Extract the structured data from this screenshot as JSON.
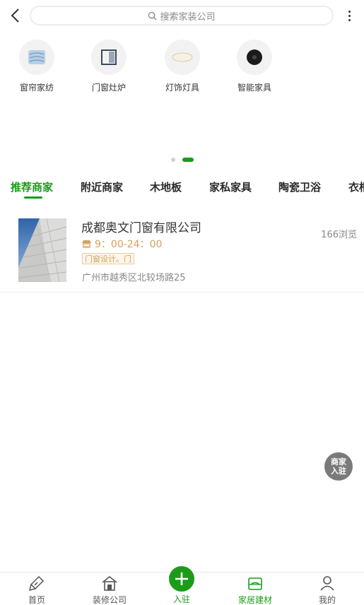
{
  "header": {
    "back_icon": "chevron-left-icon",
    "search_placeholder": "搜索家装公司",
    "more_icon": "more-vertical-icon"
  },
  "categories": [
    {
      "label": "窗帘家纺",
      "icon": "curtain-icon"
    },
    {
      "label": "门窗灶炉",
      "icon": "door-window-icon"
    },
    {
      "label": "灯饰灯具",
      "icon": "ceiling-lamp-icon"
    },
    {
      "label": "智能家具",
      "icon": "smart-speaker-icon"
    }
  ],
  "pager": {
    "count": 2,
    "active": 1
  },
  "tabs": [
    {
      "label": "推荐商家",
      "active": true
    },
    {
      "label": "附近商家",
      "active": false
    },
    {
      "label": "木地板",
      "active": false
    },
    {
      "label": "家私家具",
      "active": false
    },
    {
      "label": "陶瓷卫浴",
      "active": false
    },
    {
      "label": "衣柜",
      "active": false
    }
  ],
  "companies": [
    {
      "name": "成都奥文门窗有限公司",
      "views": "166浏览",
      "hours": "9：00-24：00",
      "tag": "门窗设计。门",
      "address": "广州市越秀区北较场路25"
    }
  ],
  "float_join": {
    "line1": "商家",
    "line2": "入驻"
  },
  "bottom_nav": {
    "home": "首页",
    "decoration": "装修公司",
    "join": "入驻",
    "materials": "家居建材",
    "mine": "我的"
  },
  "colors": {
    "accent": "#1a9c1a",
    "gold": "#d4a060"
  }
}
